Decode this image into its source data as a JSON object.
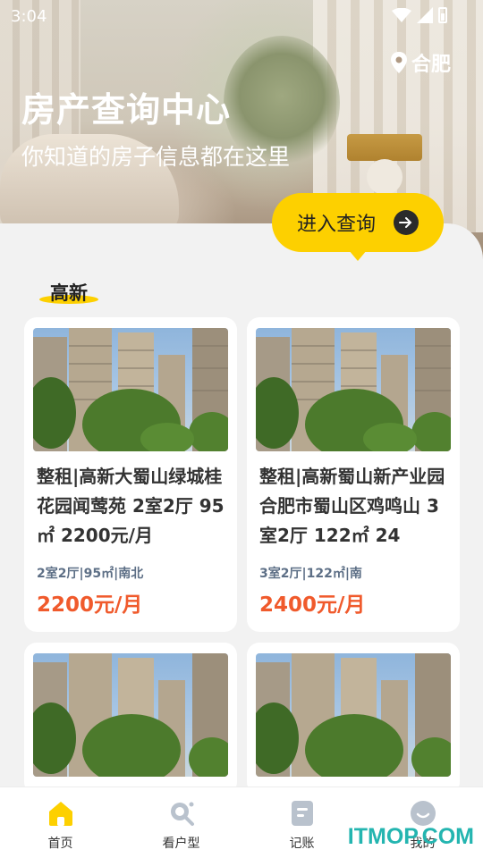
{
  "status": {
    "time": "3:04"
  },
  "header": {
    "city": "合肥",
    "title": "房产查询中心",
    "subtitle": "你知道的房子信息都在这里",
    "query_button": "进入查询"
  },
  "section": {
    "title": "高新"
  },
  "listings": [
    {
      "title": "整租|高新大蜀山绿城桂花园闻莺苑 2室2厅 95㎡ 2200元/月",
      "meta": "2室2厅|95㎡|南北",
      "price": "2200元/月"
    },
    {
      "title": "整租|高新蜀山新产业园合肥市蜀山区鸡鸣山 3室2厅 122㎡ 24",
      "meta": "3室2厅|122㎡|南",
      "price": "2400元/月"
    },
    {
      "title": "",
      "meta": "",
      "price": ""
    },
    {
      "title": "",
      "meta": "",
      "price": ""
    }
  ],
  "tabs": [
    {
      "label": "首页",
      "icon": "home-icon",
      "active": true
    },
    {
      "label": "看户型",
      "icon": "search-icon",
      "active": false
    },
    {
      "label": "记账",
      "icon": "note-icon",
      "active": false
    },
    {
      "label": "我的",
      "icon": "profile-icon",
      "active": false
    }
  ],
  "watermark": "ITMOP.COM",
  "colors": {
    "accent": "#fdd000",
    "price": "#f05a2c",
    "meta": "#5d6f86",
    "inactive_icon": "#b9c2cd"
  }
}
